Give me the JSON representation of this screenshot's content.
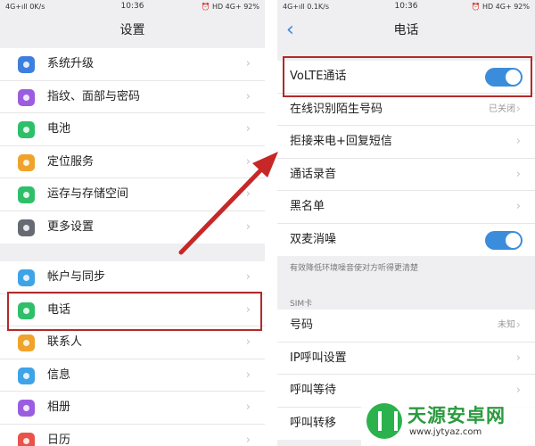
{
  "left_screen": {
    "status": {
      "left": "4G+ıll 0K/s",
      "time": "10:36",
      "right": "⏰ HD 4G+ 92%"
    },
    "title": "设置",
    "groups": [
      [
        {
          "label": "系统升级",
          "icon": "system-update-icon",
          "color": "#3d7fe0"
        },
        {
          "label": "指纹、面部与密码",
          "icon": "fingerprint-icon",
          "color": "#9b5de0"
        },
        {
          "label": "电池",
          "icon": "battery-icon",
          "color": "#2fbf6a"
        },
        {
          "label": "定位服务",
          "icon": "location-icon",
          "color": "#f0a32b"
        },
        {
          "label": "运存与存储空间",
          "icon": "storage-icon",
          "color": "#2fbf6a"
        },
        {
          "label": "更多设置",
          "icon": "wrench-icon",
          "color": "#666a73"
        }
      ],
      [
        {
          "label": "帐户与同步",
          "icon": "cloud-icon",
          "color": "#3fa3e8"
        },
        {
          "label": "电话",
          "icon": "phone-icon",
          "color": "#2fbf6a"
        },
        {
          "label": "联系人",
          "icon": "contacts-icon",
          "color": "#f0a32b"
        },
        {
          "label": "信息",
          "icon": "message-icon",
          "color": "#3fa3e8"
        },
        {
          "label": "相册",
          "icon": "gallery-icon",
          "color": "#9b5de0"
        },
        {
          "label": "日历",
          "icon": "calendar-icon",
          "color": "#e8534a"
        }
      ]
    ]
  },
  "right_screen": {
    "status": {
      "left": "4G+ıll 0.1K/s",
      "time": "10:36",
      "right": "⏰ HD 4G+ 92%"
    },
    "title": "电话",
    "back": "‹",
    "group1": [
      {
        "label": "VoLTE通话",
        "control": "toggle",
        "on": true
      },
      {
        "label": "在线识别陌生号码",
        "value": "已关闭"
      },
      {
        "label": "拒接来电+回复短信"
      },
      {
        "label": "通话录音"
      },
      {
        "label": "黑名单"
      },
      {
        "label": "双麦消噪",
        "control": "toggle",
        "on": true
      }
    ],
    "hint": "有效降低环境噪音使对方听得更清楚",
    "section_title": "SIM卡",
    "group2": [
      {
        "label": "号码",
        "value": "未知"
      },
      {
        "label": "IP呼叫设置"
      },
      {
        "label": "呼叫等待"
      },
      {
        "label": "呼叫转移"
      }
    ]
  },
  "chevron": "›",
  "watermark": {
    "title": "天源安卓网",
    "url": "www.jytyaz.com"
  }
}
